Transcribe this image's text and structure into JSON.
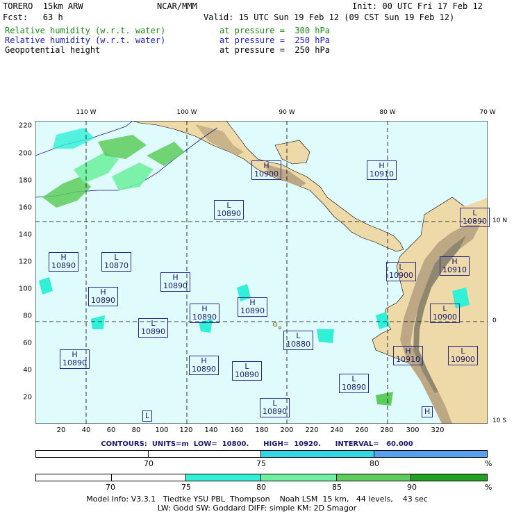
{
  "header": {
    "model": "TORERO  15km ARW",
    "org": "NCAR/MMM",
    "init": "Init: 00 UTC Fri 17 Feb 12",
    "fcst": "Fcst:   63 h",
    "valid": "Valid: 15 UTC Sun 19 Feb 12 (09 CST Sun 19 Feb 12)",
    "fields": [
      {
        "name": "Relative humidity (w.r.t. water)",
        "level": "at pressure =  300 hPa",
        "color": "#1a8a1a"
      },
      {
        "name": "Relative humidity (w.r.t. water)",
        "level": "at pressure =  250 hPa",
        "color": "#1a1acc"
      },
      {
        "name": "Geopotential height",
        "level": "at pressure =  250 hPa",
        "color": "#000000"
      }
    ]
  },
  "map": {
    "lon_labels": [
      "110 W",
      "100 W",
      "90 W",
      "80 W",
      "70 W"
    ],
    "lat_labels": [
      "10 N",
      "0",
      "10 S"
    ],
    "y_ticks": [
      "220",
      "200",
      "180",
      "160",
      "140",
      "120",
      "100",
      "80",
      "60",
      "40",
      "20"
    ],
    "x_ticks": [
      "20",
      "40",
      "60",
      "80",
      "100",
      "120",
      "140",
      "160",
      "180",
      "200",
      "220",
      "240",
      "260",
      "280",
      "300",
      "320"
    ],
    "ocean_color": "#e0fbfb",
    "centers": [
      {
        "kind": "H",
        "value": "10900"
      },
      {
        "kind": "H",
        "value": "10910"
      },
      {
        "kind": "L",
        "value": "10890"
      },
      {
        "kind": "H",
        "value": "10890"
      },
      {
        "kind": "L",
        "value": "10870"
      },
      {
        "kind": "H",
        "value": "10890"
      },
      {
        "kind": "H",
        "value": "10890"
      },
      {
        "kind": "H",
        "value": "10890"
      },
      {
        "kind": "H",
        "value": "10890"
      },
      {
        "kind": "L",
        "value": "10890"
      },
      {
        "kind": "L",
        "value": "10880"
      },
      {
        "kind": "L",
        "value": "10900"
      },
      {
        "kind": "H",
        "value": "10910"
      },
      {
        "kind": "L",
        "value": "10900"
      },
      {
        "kind": "H",
        "value": "10890"
      },
      {
        "kind": "H",
        "value": "10890"
      },
      {
        "kind": "L",
        "value": "10890"
      },
      {
        "kind": "H",
        "value": "10910"
      },
      {
        "kind": "L",
        "value": "10900"
      },
      {
        "kind": "L",
        "value": "10890"
      },
      {
        "kind": "L",
        "value": "10890"
      },
      {
        "kind": "L",
        "value": "10890"
      },
      {
        "kind": "L",
        "value": ""
      },
      {
        "kind": "H",
        "value": "10890"
      },
      {
        "kind": "H",
        "value": ""
      }
    ]
  },
  "contour_info": "CONTOURS:  UNITS=m  LOW=  10800.      HIGH=  10920.      INTERVAL=   60.000",
  "bar1": {
    "labels": [
      "70",
      "75",
      "80"
    ],
    "unit": "%",
    "colors": [
      "#ffffff",
      "#ffffff",
      "#30d8e8",
      "#5aa0f0"
    ]
  },
  "bar2": {
    "labels": [
      "70",
      "75",
      "80",
      "85",
      "90"
    ],
    "unit": "%",
    "colors": [
      "#ffffff",
      "#ffffff",
      "#30f0d8",
      "#70f0a0",
      "#5ccc5c",
      "#22a022"
    ]
  },
  "footer": {
    "line1": "Model Info: V3.3.1   Tiedtke YSU PBL  Thompson    Noah LSM  15 km,   44 levels,    43 sec",
    "line2": "LW: Godd SW: Goddard DIFF: simple KM: 2D Smagor"
  }
}
